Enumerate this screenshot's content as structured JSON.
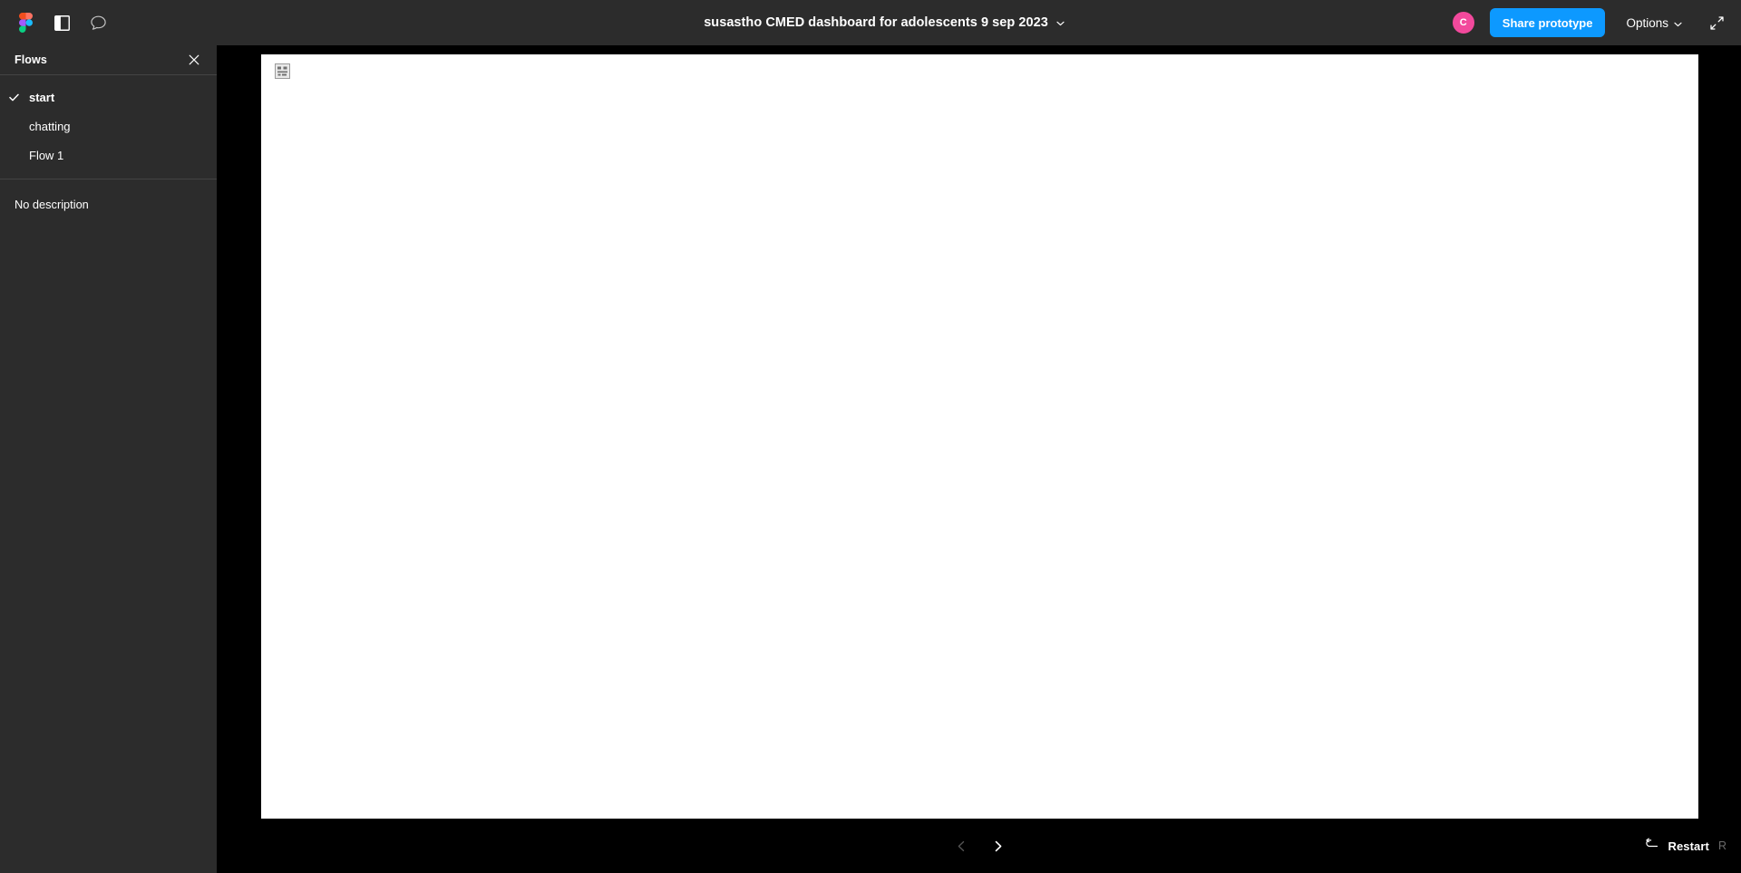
{
  "topbar": {
    "figma_logo": "figma-logo",
    "panel_toggle_tooltip": "Toggle sidebar",
    "comment_tooltip": "Comment",
    "title": "susastho CMED dashboard for adolescents 9 sep 2023",
    "title_chevron": "chevron-down",
    "avatar_initial": "C",
    "avatar_color": "#f2499c",
    "share_label": "Share prototype",
    "share_color": "#0d99ff",
    "options_label": "Options",
    "options_chevron": "chevron-down",
    "fullscreen_icon": "fullscreen-expand"
  },
  "sidebar": {
    "header_title": "Flows",
    "close_icon": "close-x",
    "flows": [
      {
        "label": "start",
        "selected": true
      },
      {
        "label": "chatting",
        "selected": false
      },
      {
        "label": "Flow 1",
        "selected": false
      }
    ],
    "description": "No description"
  },
  "canvas": {
    "frame_background": "#ffffff",
    "backdrop_color": "#000000",
    "placeholder_icon": "broken-image"
  },
  "bottombar": {
    "prev_icon": "chevron-left",
    "prev_enabled": false,
    "next_icon": "chevron-right",
    "next_enabled": true,
    "restart_icon": "restart-arrow",
    "restart_label": "Restart",
    "restart_shortcut": "R"
  }
}
